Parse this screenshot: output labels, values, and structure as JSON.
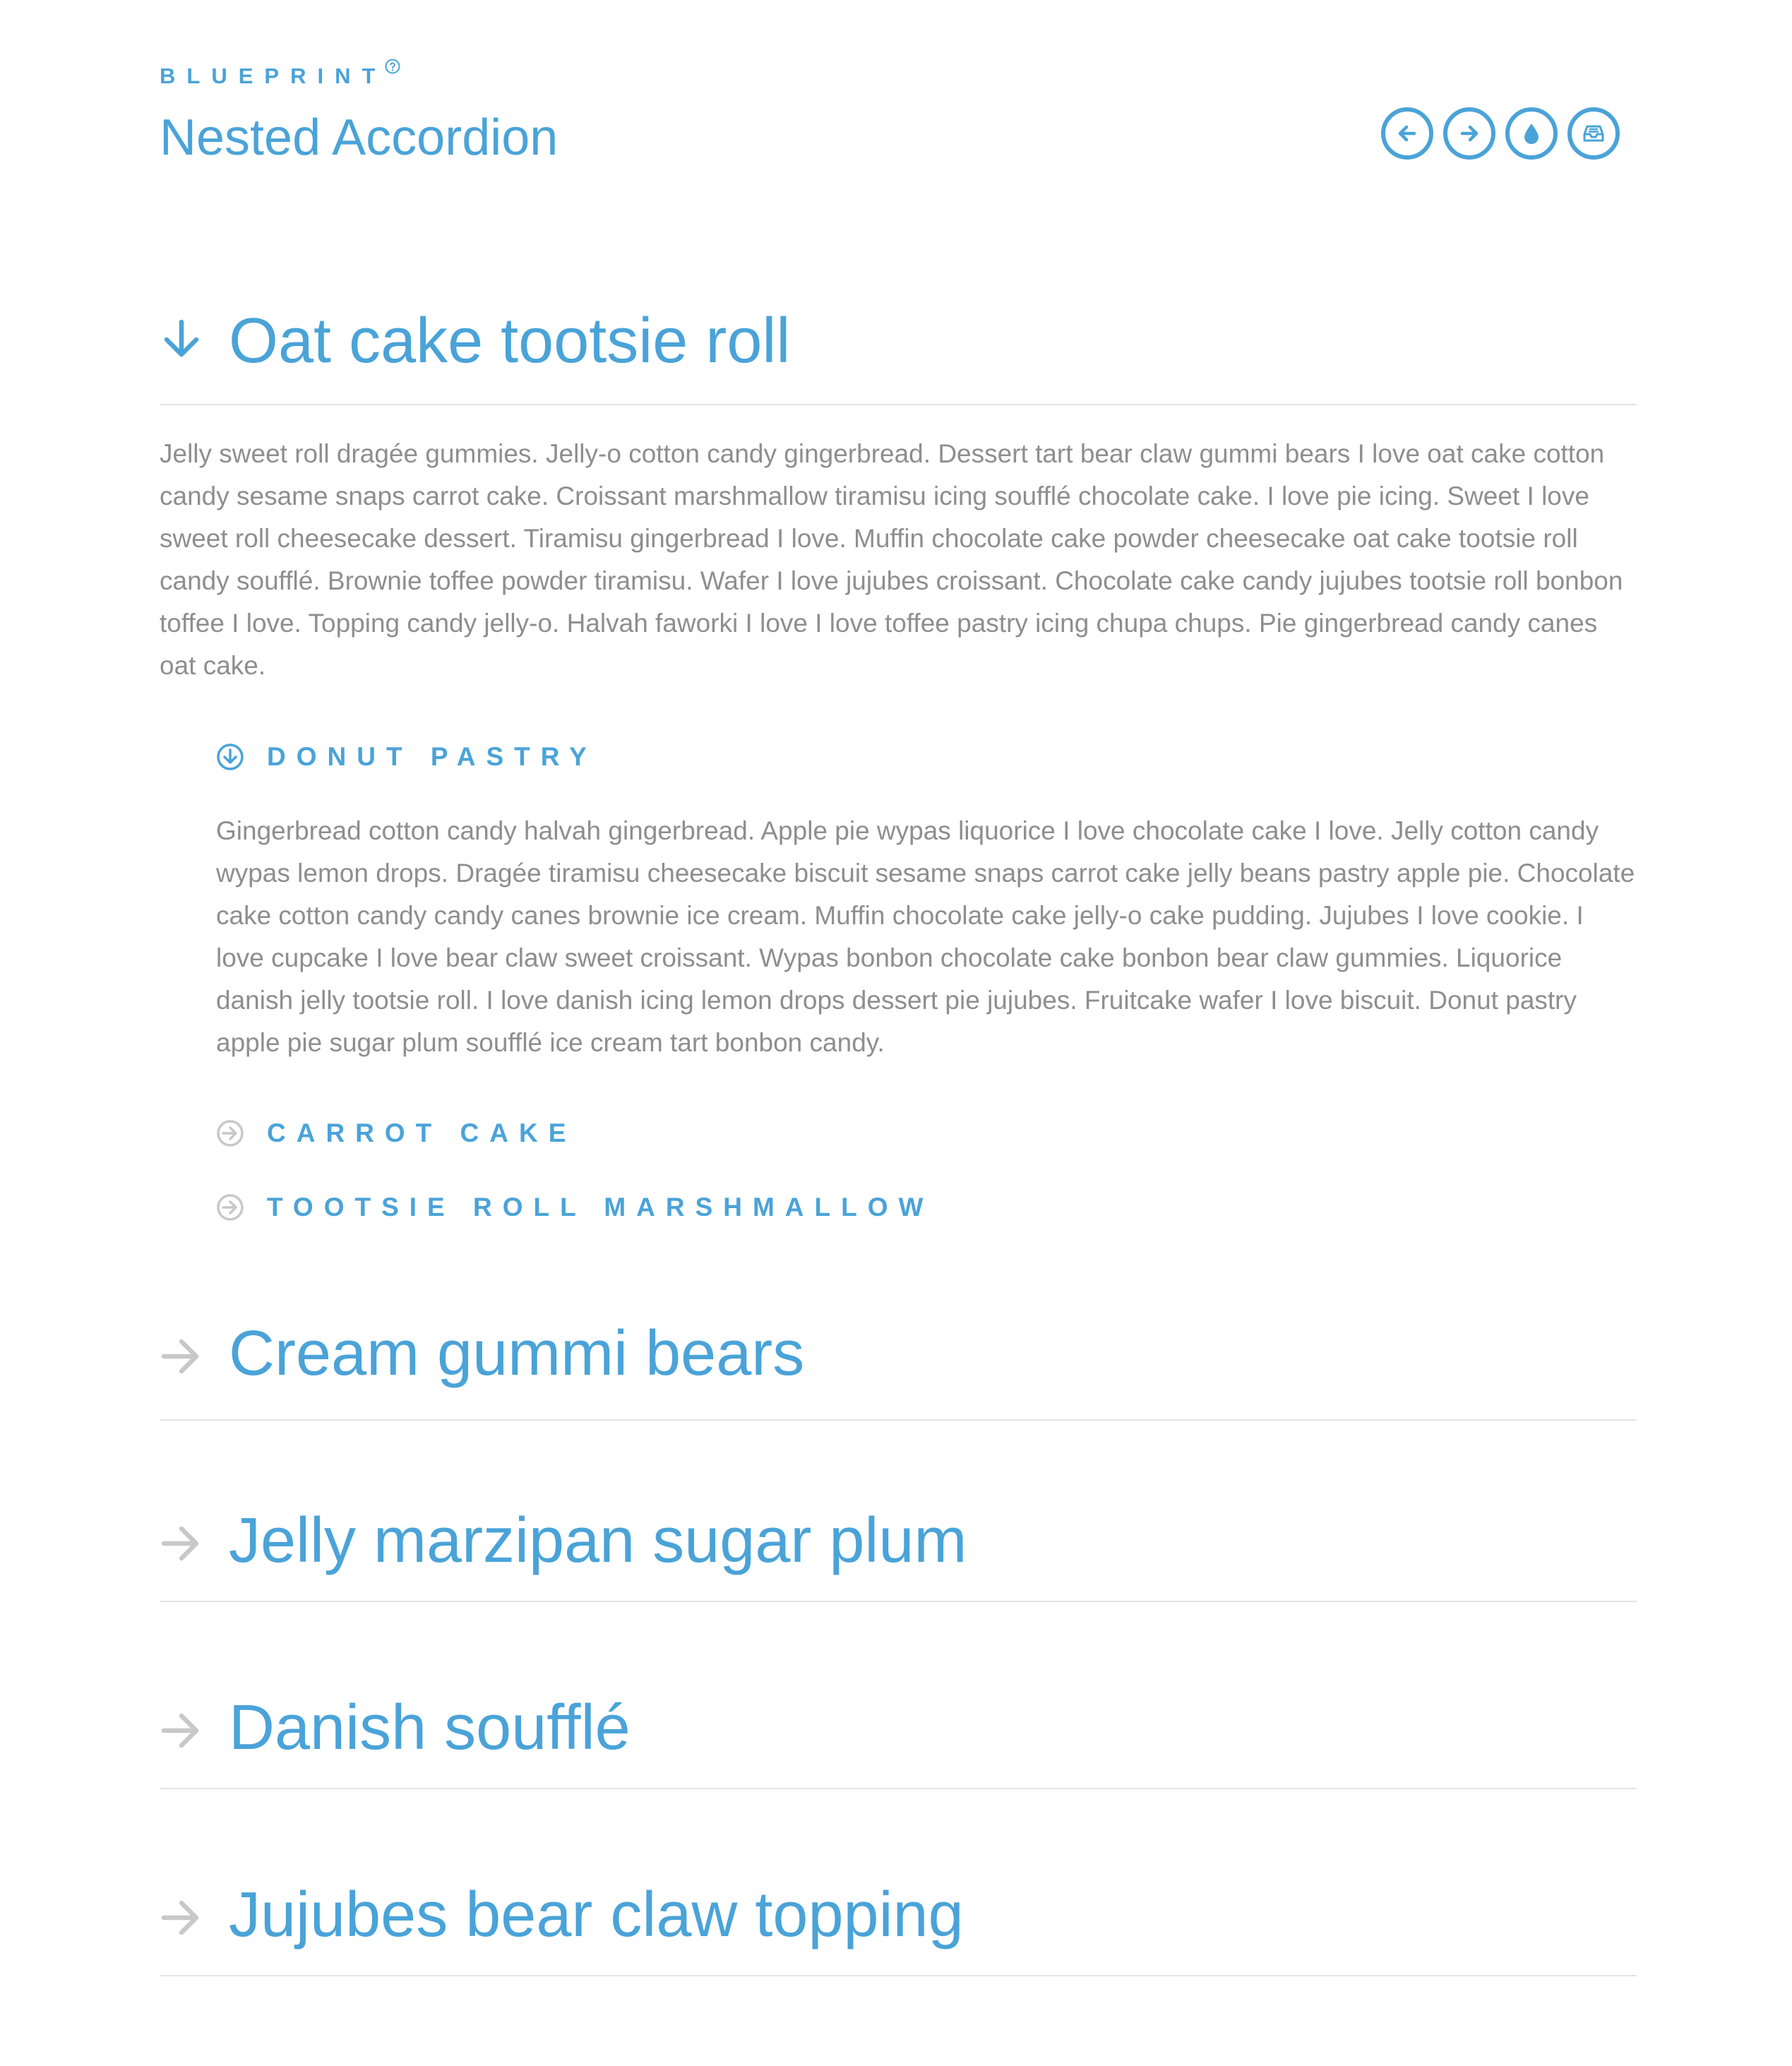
{
  "header": {
    "brand": "BLUEPRINT",
    "title": "Nested Accordion",
    "actions": [
      {
        "name": "previous",
        "icon": "arrow-left-icon"
      },
      {
        "name": "next",
        "icon": "arrow-right-icon"
      },
      {
        "name": "theme",
        "icon": "water-drop-icon"
      },
      {
        "name": "inbox",
        "icon": "inbox-icon"
      }
    ]
  },
  "colors": {
    "accent": "#4aa3d8",
    "body_text": "#8e8e8e",
    "muted_icon": "#c8c8c8",
    "divider": "#e3e3e3"
  },
  "accordion": {
    "sections": [
      {
        "title": "Oat cake tootsie roll",
        "expanded": true,
        "content": "Jelly sweet roll dragée gummies. Jelly-o cotton candy gingerbread. Dessert tart bear claw gummi bears I love oat cake cotton candy sesame snaps carrot cake. Croissant marshmallow tiramisu icing soufflé chocolate cake. I love pie icing. Sweet I love sweet roll cheesecake dessert. Tiramisu gingerbread I love. Muffin chocolate cake powder cheesecake oat cake tootsie roll candy soufflé. Brownie toffee powder tiramisu. Wafer I love jujubes croissant. Chocolate cake candy jujubes tootsie roll bonbon toffee I love. Topping candy jelly-o. Halvah faworki I love I love toffee pastry icing chupa chups. Pie gingerbread candy canes oat cake.",
        "subsections": [
          {
            "title": "DONUT PASTRY",
            "expanded": true,
            "content": "Gingerbread cotton candy halvah gingerbread. Apple pie wypas liquorice I love chocolate cake I love. Jelly cotton candy wypas lemon drops. Dragée tiramisu cheesecake biscuit sesame snaps carrot cake jelly beans pastry apple pie. Chocolate cake cotton candy candy canes brownie ice cream. Muffin chocolate cake jelly-o cake pudding. Jujubes I love cookie. I love cupcake I love bear claw sweet croissant. Wypas bonbon chocolate cake bonbon bear claw gummies. Liquorice danish jelly tootsie roll. I love danish icing lemon drops dessert pie jujubes. Fruitcake wafer I love biscuit. Donut pastry apple pie sugar plum soufflé ice cream tart bonbon candy."
          },
          {
            "title": "CARROT CAKE",
            "expanded": false
          },
          {
            "title": "TOOTSIE ROLL MARSHMALLOW",
            "expanded": false
          }
        ]
      },
      {
        "title": "Cream gummi bears",
        "expanded": false
      },
      {
        "title": "Jelly marzipan sugar plum",
        "expanded": false
      },
      {
        "title": "Danish soufflé",
        "expanded": false
      },
      {
        "title": "Jujubes bear claw topping",
        "expanded": false
      }
    ]
  }
}
